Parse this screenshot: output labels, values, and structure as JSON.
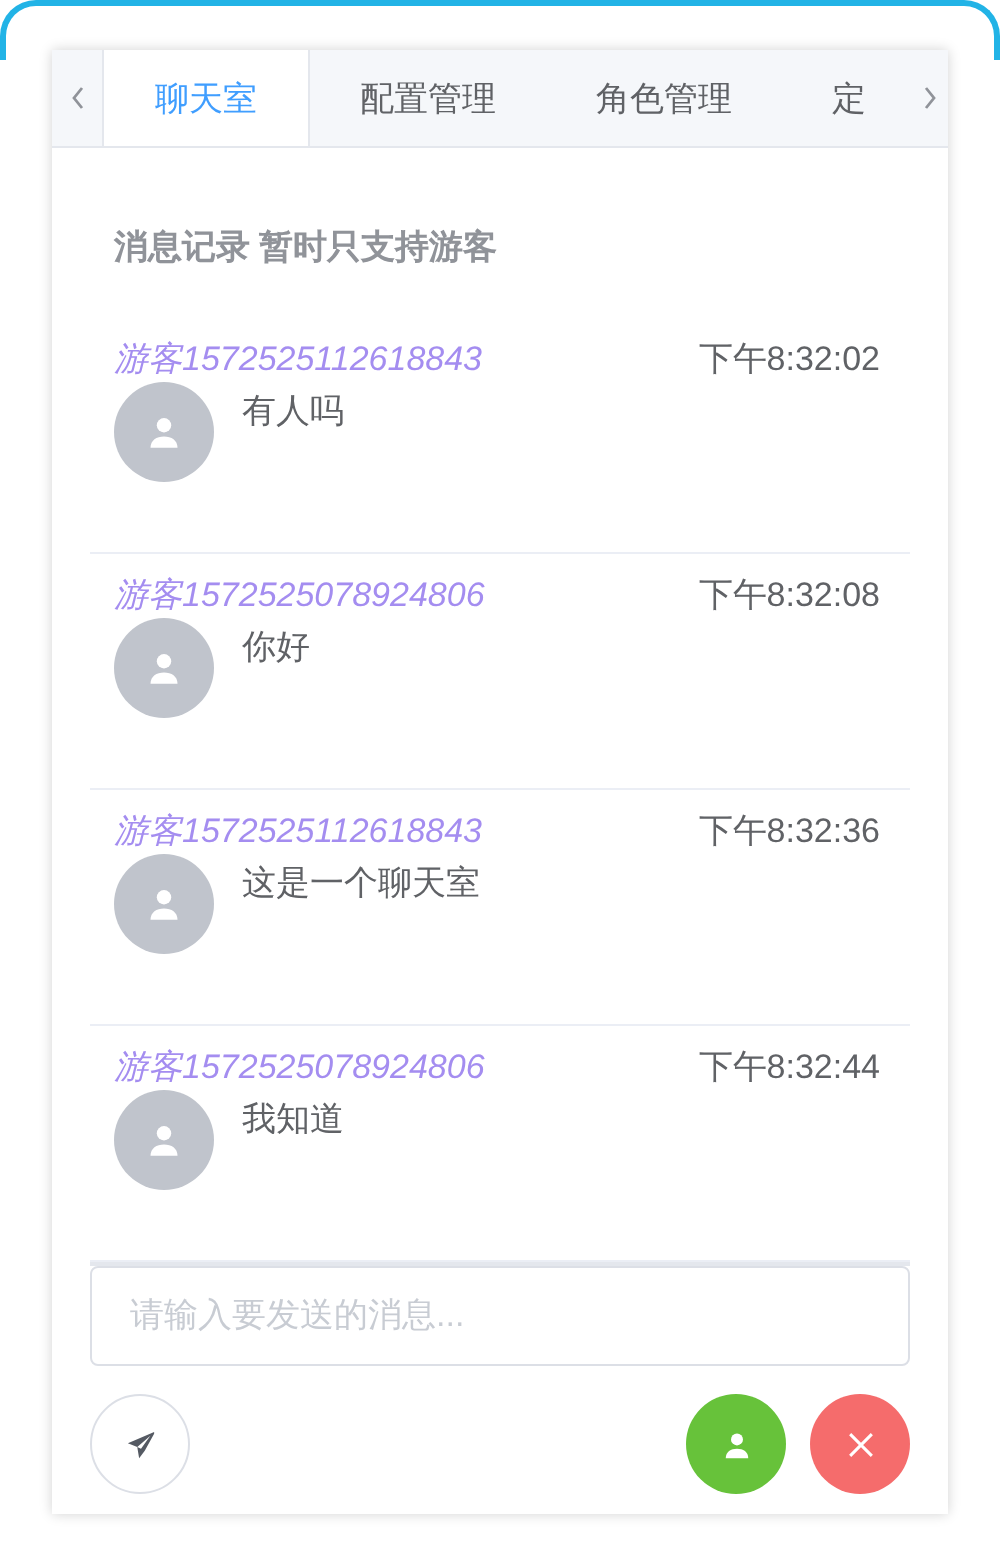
{
  "tabs": [
    {
      "label": "聊天室",
      "selected": true
    },
    {
      "label": "配置管理",
      "selected": false
    },
    {
      "label": "角色管理",
      "selected": false
    },
    {
      "label": "定",
      "selected": false
    }
  ],
  "heading": "消息记录 暂时只支持游客",
  "messages": [
    {
      "sender": "游客1572525112618843",
      "time": "下午8:32:02",
      "text": "有人吗"
    },
    {
      "sender": "游客1572525078924806",
      "time": "下午8:32:08",
      "text": "你好"
    },
    {
      "sender": "游客1572525112618843",
      "time": "下午8:32:36",
      "text": "这是一个聊天室"
    },
    {
      "sender": "游客1572525078924806",
      "time": "下午8:32:44",
      "text": "我知道"
    }
  ],
  "input": {
    "placeholder": "请输入要发送的消息..."
  }
}
